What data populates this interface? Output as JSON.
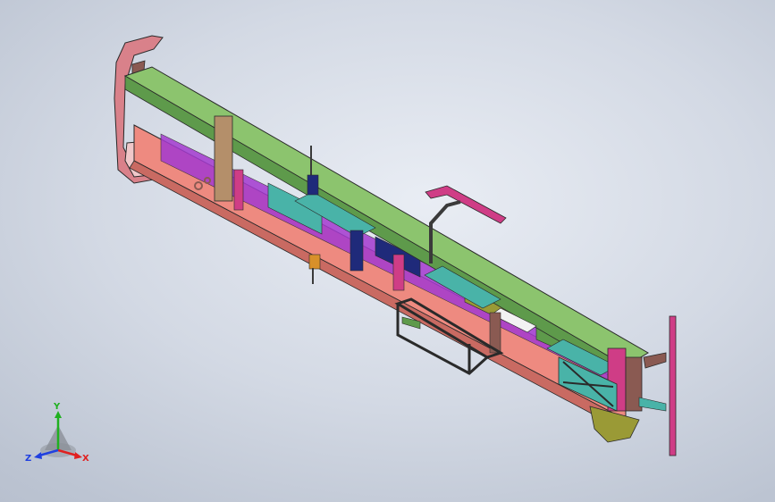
{
  "viewport": {
    "background_top": "#e9edf4",
    "background_bottom": "#b3bbca"
  },
  "model": {
    "part_colors": {
      "top_rail": "#8cc46e",
      "top_rail_dark": "#5e9a4b",
      "bottom_rail": "#ee8a80",
      "bottom_rail_dark": "#c96a62",
      "teal": "#49b3a8",
      "purple": "#a43ad0",
      "magenta": "#cf3d86",
      "brown": "#8a5a52",
      "olive": "#9a9a36",
      "navy": "#1f2a7a",
      "orange": "#d8902a",
      "outline": "#2a2a2a"
    }
  },
  "triad": {
    "x_label": "X",
    "y_label": "Y",
    "z_label": "Z",
    "x_color": "#e02020",
    "y_color": "#20b020",
    "z_color": "#2040e0"
  }
}
